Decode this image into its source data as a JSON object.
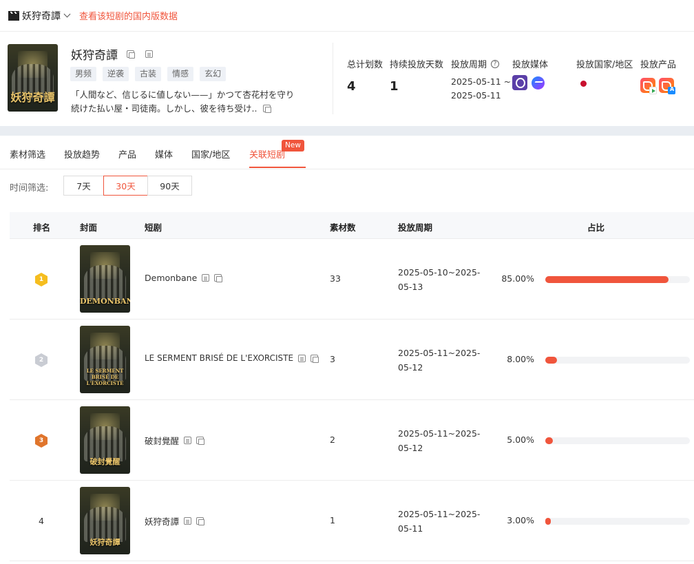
{
  "topbar": {
    "title": "妖狩奇譚",
    "link": "查看该短剧的国内版数据"
  },
  "drama": {
    "name": "妖狩奇譚",
    "poster_title": "妖狩奇譚",
    "tags": [
      "男频",
      "逆袭",
      "古装",
      "情感",
      "玄幻"
    ],
    "description": "「人間など、信じるに値しない——」かつて杏花村を守り続けた払い屋・司徒南。しかし、彼を待ち受け..",
    "stats": {
      "total_label": "总计划数",
      "total_value": "4",
      "days_label": "持续投放天数",
      "days_value": "1",
      "period_label": "投放周期",
      "period_start": "2025-05-11 ~",
      "period_end": "2025-05-11",
      "media_label": "投放媒体",
      "country_label": "投放国家/地区",
      "product_label": "投放产品"
    }
  },
  "tabs": [
    {
      "label": "素材筛选"
    },
    {
      "label": "投放趋势"
    },
    {
      "label": "产品"
    },
    {
      "label": "媒体"
    },
    {
      "label": "国家/地区"
    },
    {
      "label": "关联短剧"
    }
  ],
  "new_badge": "New",
  "time_filter": {
    "label": "时间筛选:",
    "options": [
      "7天",
      "30天",
      "90天"
    ],
    "selected": "30天"
  },
  "table": {
    "headers": {
      "rank": "排名",
      "cover": "封面",
      "drama": "短剧",
      "count": "素材数",
      "period": "投放周期",
      "share": "占比"
    },
    "rows": [
      {
        "rank": "1",
        "medal": "gold",
        "name": "Demonbane",
        "poster_title": "DEMONBANE",
        "count": "33",
        "period": "2025-05-10~2025-05-13",
        "share_label": "85.00%",
        "share": 85
      },
      {
        "rank": "2",
        "medal": "silver",
        "name": "LE SERMENT BRISÉ DE L'EXORCISTE",
        "poster_title": "LE SERMENT BRISÉ DE L'EXORCISTE",
        "count": "3",
        "period": "2025-05-11~2025-05-12",
        "share_label": "8.00%",
        "share": 8
      },
      {
        "rank": "3",
        "medal": "bronze",
        "name": "破封覺醒",
        "poster_title": "破封覺醒",
        "count": "2",
        "period": "2025-05-11~2025-05-12",
        "share_label": "5.00%",
        "share": 5
      },
      {
        "rank": "4",
        "medal": "",
        "name": "妖狩奇譚",
        "poster_title": "妖狩奇譚",
        "count": "1",
        "period": "2025-05-11~2025-05-11",
        "share_label": "3.00%",
        "share": 3
      }
    ]
  },
  "colors": {
    "accent": "#f0553c",
    "gold": "#f5bd1f",
    "silver": "#c9ccd3",
    "bronze": "#e0752c"
  }
}
